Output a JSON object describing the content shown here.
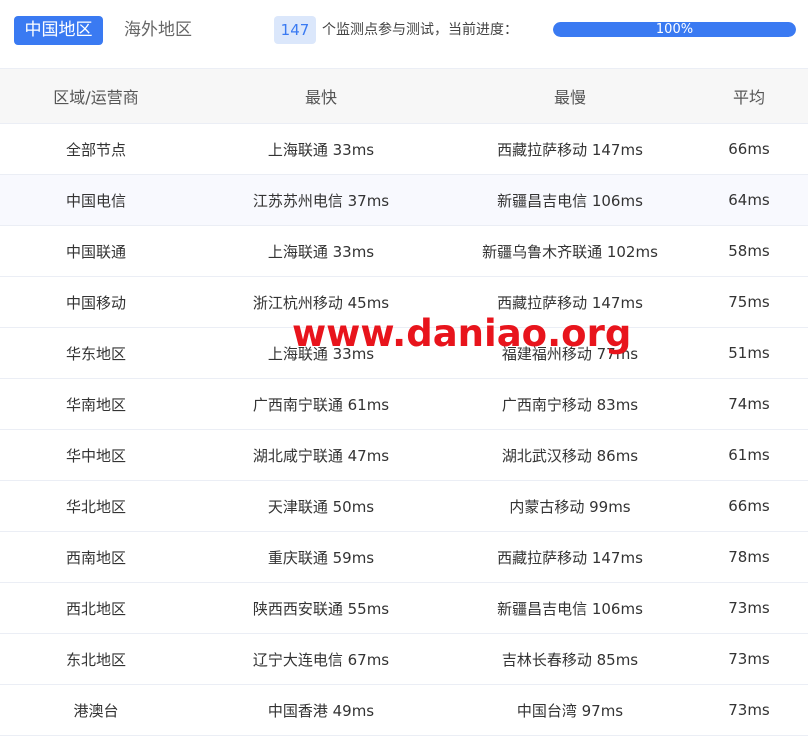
{
  "tabs": {
    "active": "中国地区",
    "inactive": "海外地区"
  },
  "progress": {
    "count": "147",
    "text": "个监测点参与测试，当前进度：",
    "percent_label": "100%",
    "percent": 100
  },
  "colors": {
    "accent": "#3a7af2",
    "watermark": "#e8141c"
  },
  "table": {
    "headers": [
      "区域/运营商",
      "最快",
      "最慢",
      "平均"
    ],
    "rows": [
      [
        "全部节点",
        "上海联通 33ms",
        "西藏拉萨移动 147ms",
        "66ms"
      ],
      [
        "中国电信",
        "江苏苏州电信 37ms",
        "新疆昌吉电信 106ms",
        "64ms"
      ],
      [
        "中国联通",
        "上海联通 33ms",
        "新疆乌鲁木齐联通 102ms",
        "58ms"
      ],
      [
        "中国移动",
        "浙江杭州移动 45ms",
        "西藏拉萨移动 147ms",
        "75ms"
      ],
      [
        "华东地区",
        "上海联通 33ms",
        "福建福州移动 77ms",
        "51ms"
      ],
      [
        "华南地区",
        "广西南宁联通 61ms",
        "广西南宁移动 83ms",
        "74ms"
      ],
      [
        "华中地区",
        "湖北咸宁联通 47ms",
        "湖北武汉移动 86ms",
        "61ms"
      ],
      [
        "华北地区",
        "天津联通 50ms",
        "内蒙古移动 99ms",
        "66ms"
      ],
      [
        "西南地区",
        "重庆联通 59ms",
        "西藏拉萨移动 147ms",
        "78ms"
      ],
      [
        "西北地区",
        "陕西西安联通 55ms",
        "新疆昌吉电信 106ms",
        "73ms"
      ],
      [
        "东北地区",
        "辽宁大连电信 67ms",
        "吉林长春移动 85ms",
        "73ms"
      ],
      [
        "港澳台",
        "中国香港 49ms",
        "中国台湾 97ms",
        "73ms"
      ]
    ]
  },
  "watermark": "www.daniao.org"
}
